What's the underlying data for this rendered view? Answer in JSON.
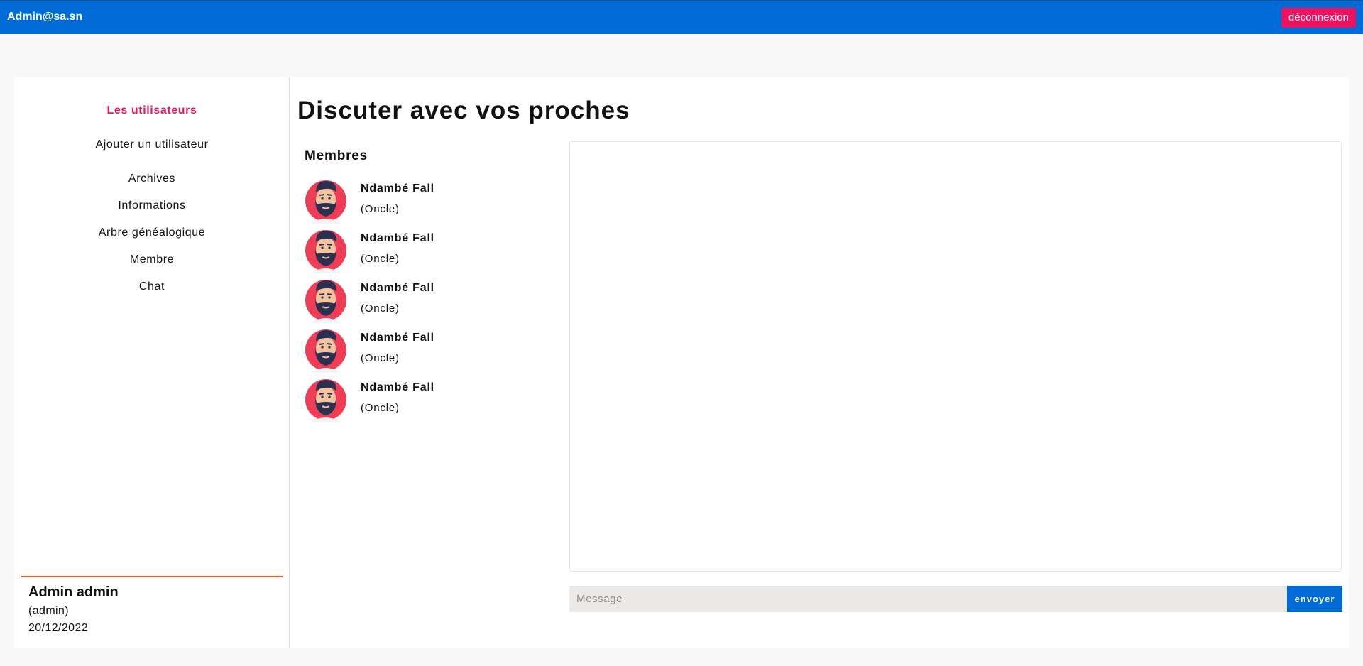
{
  "topbar": {
    "brand": "Admin@sa.sn",
    "logout_label": "déconnexion",
    "background": "#006bd6",
    "logout_color": "#f0105e"
  },
  "sidebar": {
    "items": [
      {
        "label": "Les utilisateurs",
        "active": true
      },
      {
        "label": "Ajouter un utilisateur"
      },
      {
        "label": "Archives"
      },
      {
        "label": "Informations"
      },
      {
        "label": "Arbre généalogique"
      },
      {
        "label": "Membre"
      },
      {
        "label": "Chat"
      }
    ],
    "active_color": "#e8175d"
  },
  "profile": {
    "name": "Admin admin",
    "role": "(admin)",
    "date": "20/12/2022"
  },
  "main": {
    "title": "Discuter avec vos proches",
    "members_title": "Membres",
    "members": [
      {
        "name": "Ndambé Fall",
        "relation": "(Oncle)",
        "avatar": "bearded-man-avatar"
      },
      {
        "name": "Ndambé Fall",
        "relation": "(Oncle)",
        "avatar": "bearded-man-avatar"
      },
      {
        "name": "Ndambé Fall",
        "relation": "(Oncle)",
        "avatar": "bearded-man-avatar"
      },
      {
        "name": "Ndambé Fall",
        "relation": "(Oncle)",
        "avatar": "bearded-man-avatar"
      },
      {
        "name": "Ndambé Fall",
        "relation": "(Oncle)",
        "avatar": "bearded-man-avatar"
      }
    ],
    "message_placeholder": "Message",
    "send_label": "envoyer"
  }
}
